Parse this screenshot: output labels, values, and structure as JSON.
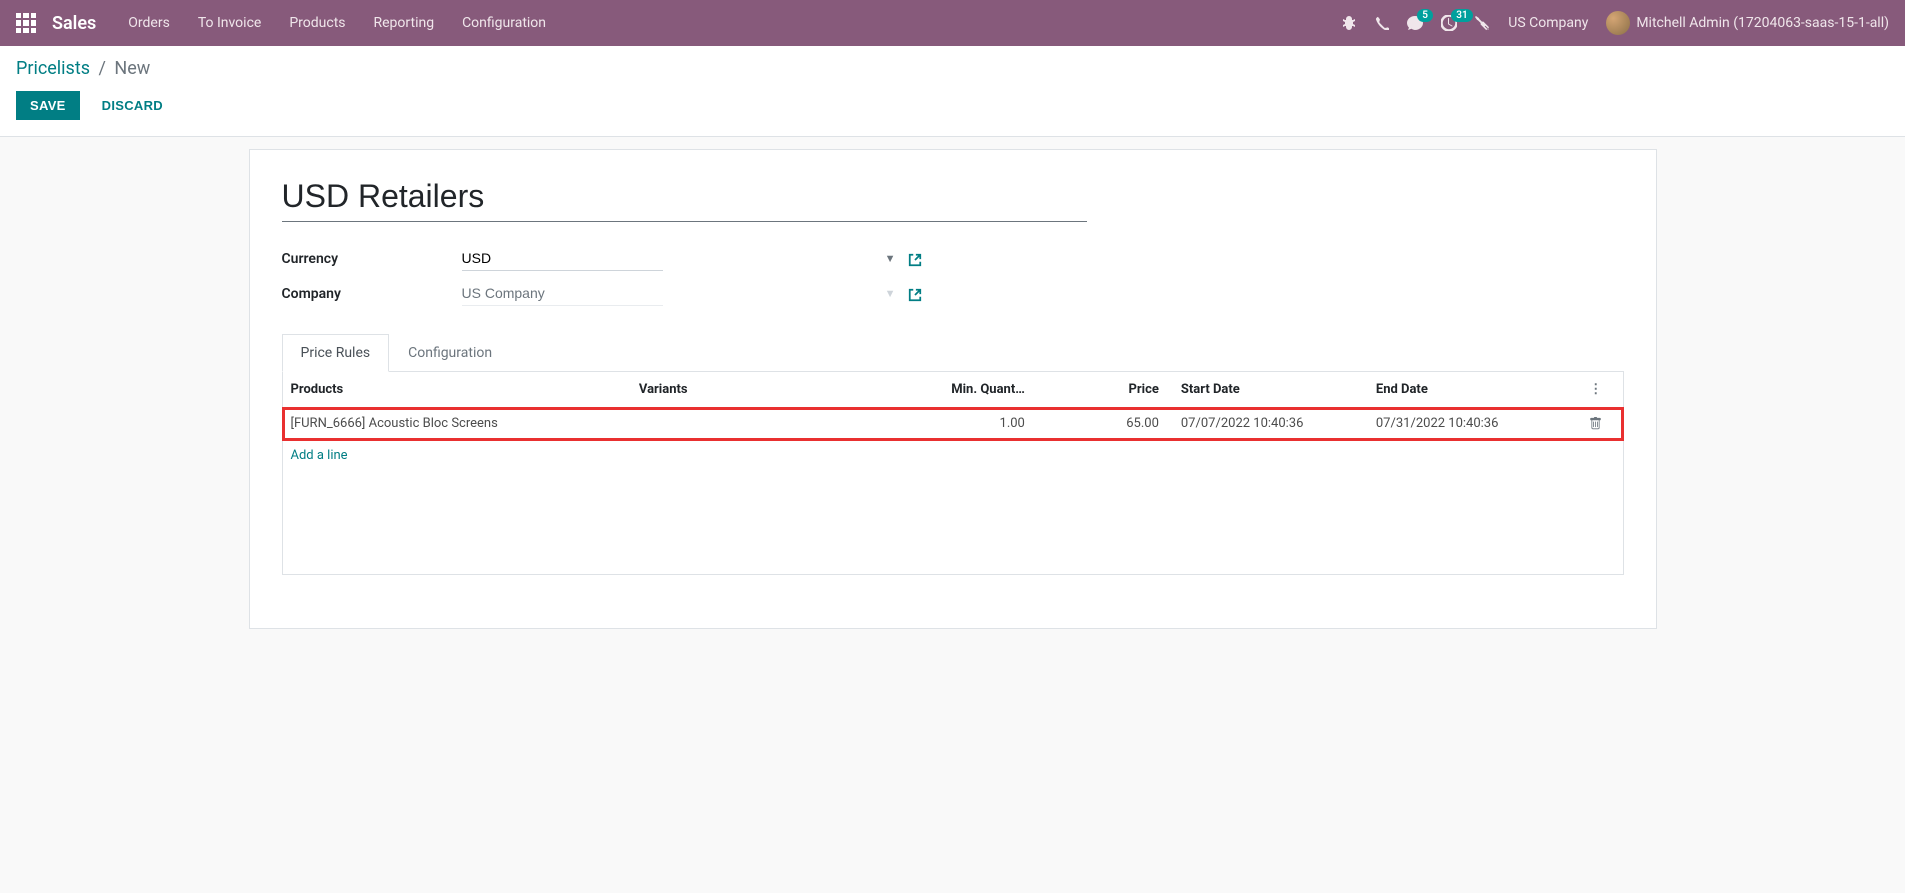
{
  "navbar": {
    "brand": "Sales",
    "menu": [
      "Orders",
      "To Invoice",
      "Products",
      "Reporting",
      "Configuration"
    ],
    "messaging_count": "5",
    "activities_count": "31",
    "company": "US Company",
    "user": "Mitchell Admin (17204063-saas-15-1-all)"
  },
  "breadcrumb": {
    "parent": "Pricelists",
    "current": "New"
  },
  "buttons": {
    "save": "SAVE",
    "discard": "DISCARD"
  },
  "form": {
    "name": "USD Retailers",
    "currency_label": "Currency",
    "currency_value": "USD",
    "company_label": "Company",
    "company_value": "US Company"
  },
  "tabs": {
    "price_rules": "Price Rules",
    "configuration": "Configuration"
  },
  "table": {
    "headers": {
      "products": "Products",
      "variants": "Variants",
      "min_qty": "Min. Quant…",
      "price": "Price",
      "start_date": "Start Date",
      "end_date": "End Date"
    },
    "rows": [
      {
        "product": "[FURN_6666] Acoustic Bloc Screens",
        "variant": "",
        "min_qty": "1.00",
        "price": "65.00",
        "start_date": "07/07/2022 10:40:36",
        "end_date": "07/31/2022 10:40:36"
      }
    ],
    "add_line": "Add a line"
  }
}
